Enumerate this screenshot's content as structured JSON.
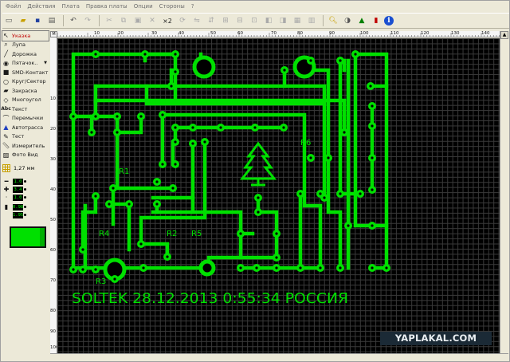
{
  "menu": [
    "Файл",
    "Действия",
    "Плата",
    "Правка платы",
    "Опции",
    "Стороны",
    "?"
  ],
  "toolbar": {
    "zoom_label": "×2"
  },
  "tools": [
    {
      "label": "Указка",
      "icon": "pointer-icon"
    },
    {
      "label": "Лупа",
      "icon": "magnifier-icon"
    },
    {
      "label": "Дорожка",
      "icon": "track-icon"
    },
    {
      "label": "Пятачок..",
      "icon": "pad-icon"
    },
    {
      "label": "SMD-Контакт",
      "icon": "smd-icon"
    },
    {
      "label": "Круг/Сектор",
      "icon": "circle-icon"
    },
    {
      "label": "Закраска",
      "icon": "fill-icon"
    },
    {
      "label": "Многоугол",
      "icon": "polygon-icon"
    },
    {
      "label": "Текст",
      "icon": "text-icon"
    },
    {
      "label": "Перемычки",
      "icon": "jumper-icon"
    },
    {
      "label": "Автотрасса",
      "icon": "autoroute-icon"
    },
    {
      "label": "Тест",
      "icon": "test-icon"
    },
    {
      "label": "Измеритель",
      "icon": "ruler-icon"
    },
    {
      "label": "Фото Вид",
      "icon": "photo-icon"
    }
  ],
  "grid_value": "1,27 мм",
  "params": {
    "track_width": "1.0",
    "pad_outer": "3.4",
    "pad_inner": "1.0",
    "smd_w": "0.98",
    "smd_h": "1.95"
  },
  "ruler": {
    "corner": "M",
    "h_labels": [
      "10",
      "20",
      "30",
      "40",
      "50",
      "60",
      "70",
      "80",
      "90",
      "100",
      "110",
      "120",
      "130",
      "140"
    ],
    "v_labels": [
      "10",
      "20",
      "30",
      "40",
      "50",
      "60",
      "70",
      "80",
      "90",
      "100"
    ]
  },
  "board": {
    "labels": [
      "R1",
      "R2",
      "R3",
      "R4",
      "R5",
      "R6"
    ],
    "text": "SOLTEK 28.12.2013 0:55:34 РОССИЯ",
    "track_color": "#00e000",
    "background": "#000000"
  },
  "watermark": "YAPLAKAL.COM"
}
